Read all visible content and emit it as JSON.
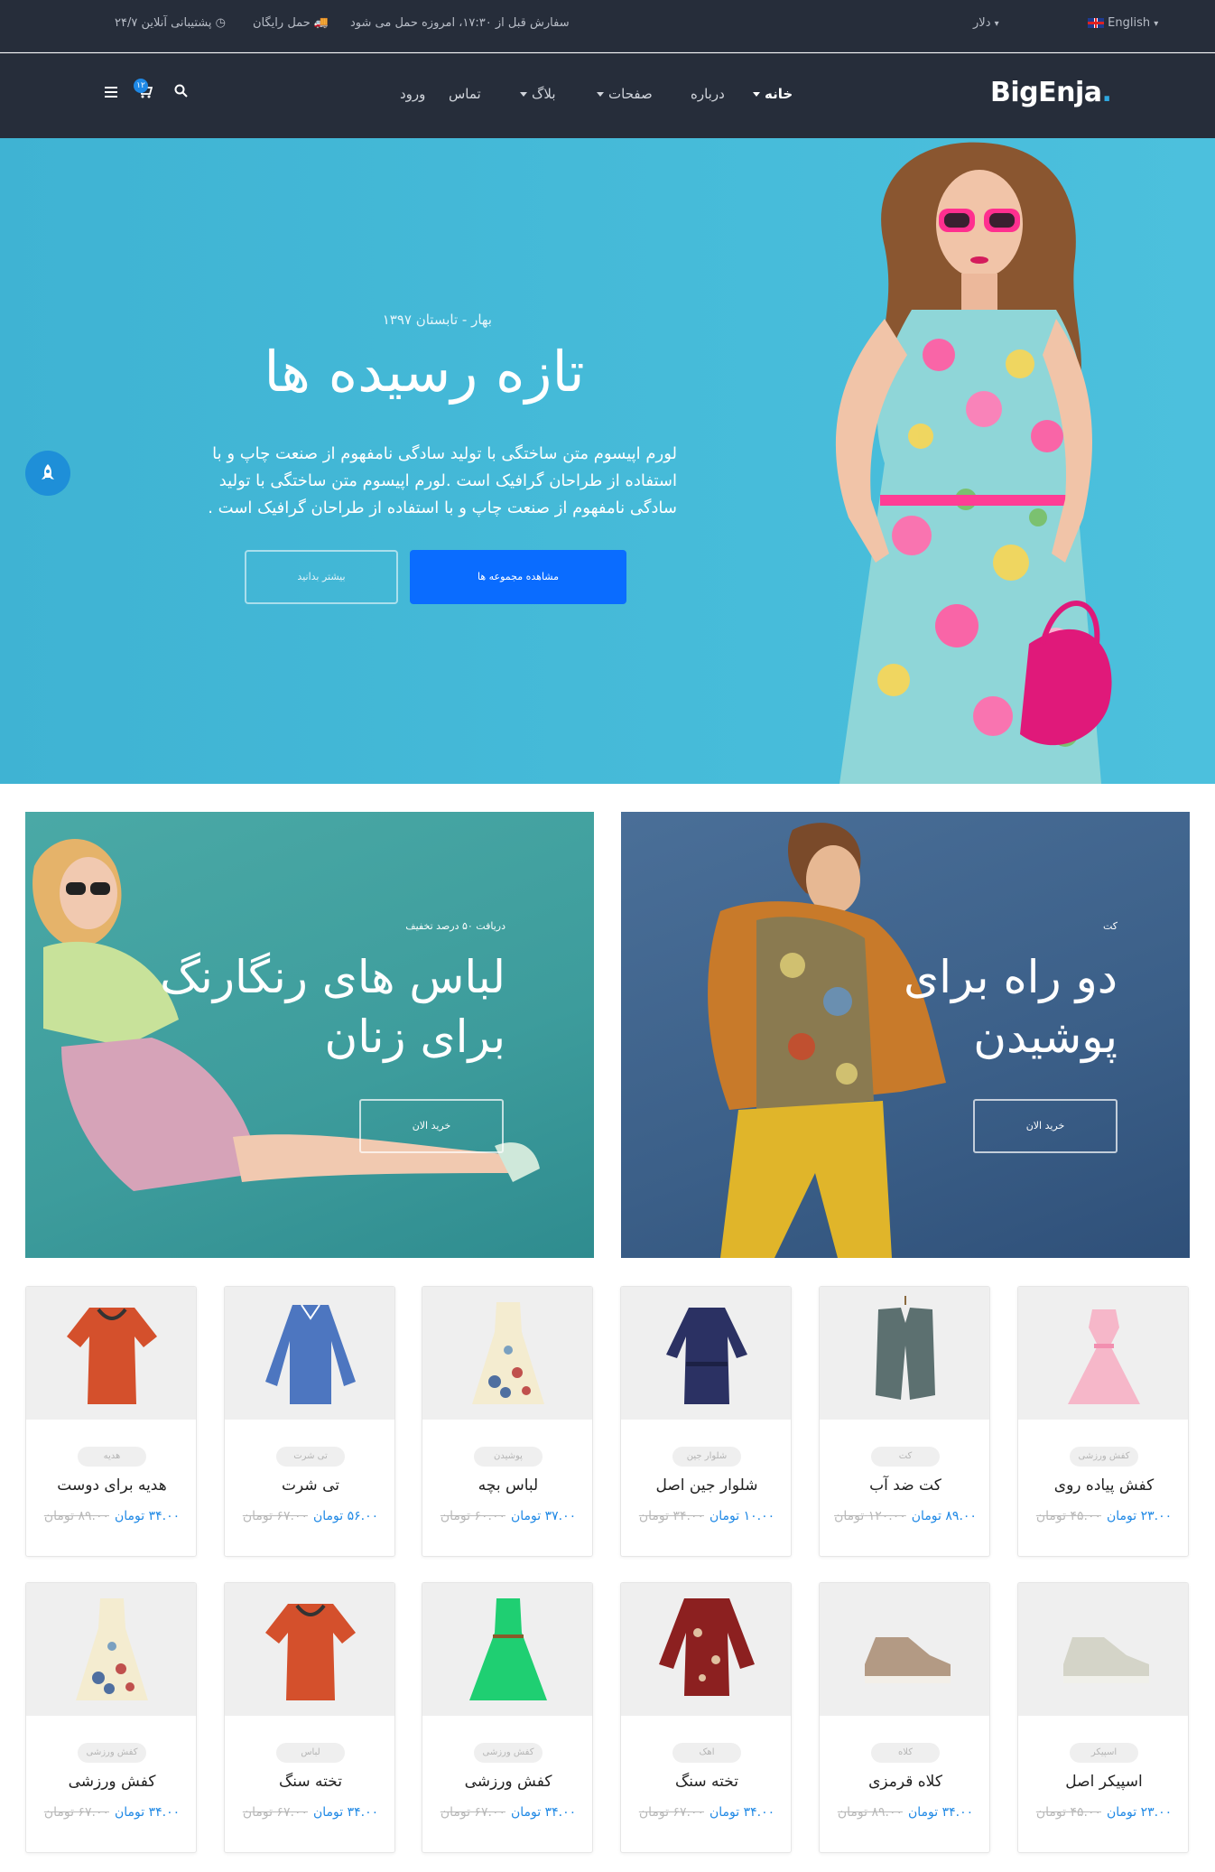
{
  "colors": {
    "topbar": "#262d3a",
    "hero_bg": "#46bbd9",
    "primary": "#0a6cff",
    "price": "#1e88e5"
  },
  "topbar": {
    "language": "English",
    "currency": "دلار",
    "order_note": "سفارش قبل از ۱۷:۳۰، امروزه حمل می شود",
    "free_shipping": "حمل رایگان",
    "support": "پشتیبانی آنلاین ۲۴/۷"
  },
  "navbar": {
    "logo_text": "BigEnja",
    "logo_dot": ".",
    "items": [
      {
        "label": "خانه",
        "dropdown": true,
        "active": true
      },
      {
        "label": "درباره",
        "dropdown": false,
        "active": false
      },
      {
        "label": "صفحات",
        "dropdown": true,
        "active": false
      },
      {
        "label": "بلاگ",
        "dropdown": true,
        "active": false
      },
      {
        "label": "تماس",
        "dropdown": false,
        "active": false
      },
      {
        "label": "ورود",
        "dropdown": false,
        "active": false
      }
    ],
    "cart_count": "۱۲"
  },
  "hero": {
    "subtitle": "بهار - تابستان ۱۳۹۷",
    "title": "تازه رسیده ها",
    "body": "لورم اپیسوم متن ساختگی با تولید سادگی نامفهوم از صنعت چاپ و با استفاده از طراحان گرافیک است .لورم اپیسوم متن ساختگی با تولید سادگی نامفهوم از صنعت چاپ و با استفاده از طراحان گرافیک است .",
    "secondary_button": "بیشتر بدانید",
    "primary_button": "مشاهده مجموعه ها"
  },
  "banners": [
    {
      "tag": "دریافت ۵۰ درصد تخفیف",
      "title_line1": "لباس های رنگارنگ",
      "title_line2": "برای زنان",
      "button": "خرید الان"
    },
    {
      "tag": "کت",
      "title_line1": "دو راه برای",
      "title_line2": "پوشیدن",
      "button": "خرید الان"
    }
  ],
  "currency_word": "تومان",
  "products": [
    {
      "name": "کفش پیاده روی",
      "category": "کفش ورزشی",
      "price": "۲۳.۰۰",
      "old_price": "۴۵.۰۰",
      "image": "pink-dress"
    },
    {
      "name": "کت ضد آب",
      "category": "کت",
      "price": "۸۹.۰۰",
      "old_price": "۱۲۰.۰۰",
      "image": "vest"
    },
    {
      "name": "شلوار جین اصل",
      "category": "شلوار جین",
      "price": "۱۰.۰۰",
      "old_price": "۳۴.۰۰",
      "image": "navy-dress"
    },
    {
      "name": "لباس بچه",
      "category": "پوشیدن",
      "price": "۳۷.۰۰",
      "old_price": "۶۰.۰۰",
      "image": "floral-dress"
    },
    {
      "name": "تی شرت",
      "category": "تی شرت",
      "price": "۵۶.۰۰",
      "old_price": "۶۷.۰۰",
      "image": "blue-shirt"
    },
    {
      "name": "هدیه برای دوست",
      "category": "هدیه",
      "price": "۳۴.۰۰",
      "old_price": "۸۹.۰۰",
      "image": "red-top"
    },
    {
      "name": "اسپیکر اصل",
      "category": "اسپیکر",
      "price": "۲۳.۰۰",
      "old_price": "۴۵.۰۰",
      "image": "grey-sneaker"
    },
    {
      "name": "کلاه قرمزی",
      "category": "کلاه",
      "price": "۳۴.۰۰",
      "old_price": "۸۹.۰۰",
      "image": "brown-sneaker"
    },
    {
      "name": "تخته سنگ",
      "category": "اهک",
      "price": "۳۴.۰۰",
      "old_price": "۶۷.۰۰",
      "image": "red-blouse"
    },
    {
      "name": "کفش ورزشی",
      "category": "کفش ورزشی",
      "price": "۳۴.۰۰",
      "old_price": "۶۷.۰۰",
      "image": "green-dress"
    },
    {
      "name": "تخته سنگ",
      "category": "لباس",
      "price": "۳۴.۰۰",
      "old_price": "۶۷.۰۰",
      "image": "red-top"
    },
    {
      "name": "کفش ورزشی",
      "category": "کفش ورزشی",
      "price": "۳۴.۰۰",
      "old_price": "۶۷.۰۰",
      "image": "floral-dress"
    }
  ]
}
